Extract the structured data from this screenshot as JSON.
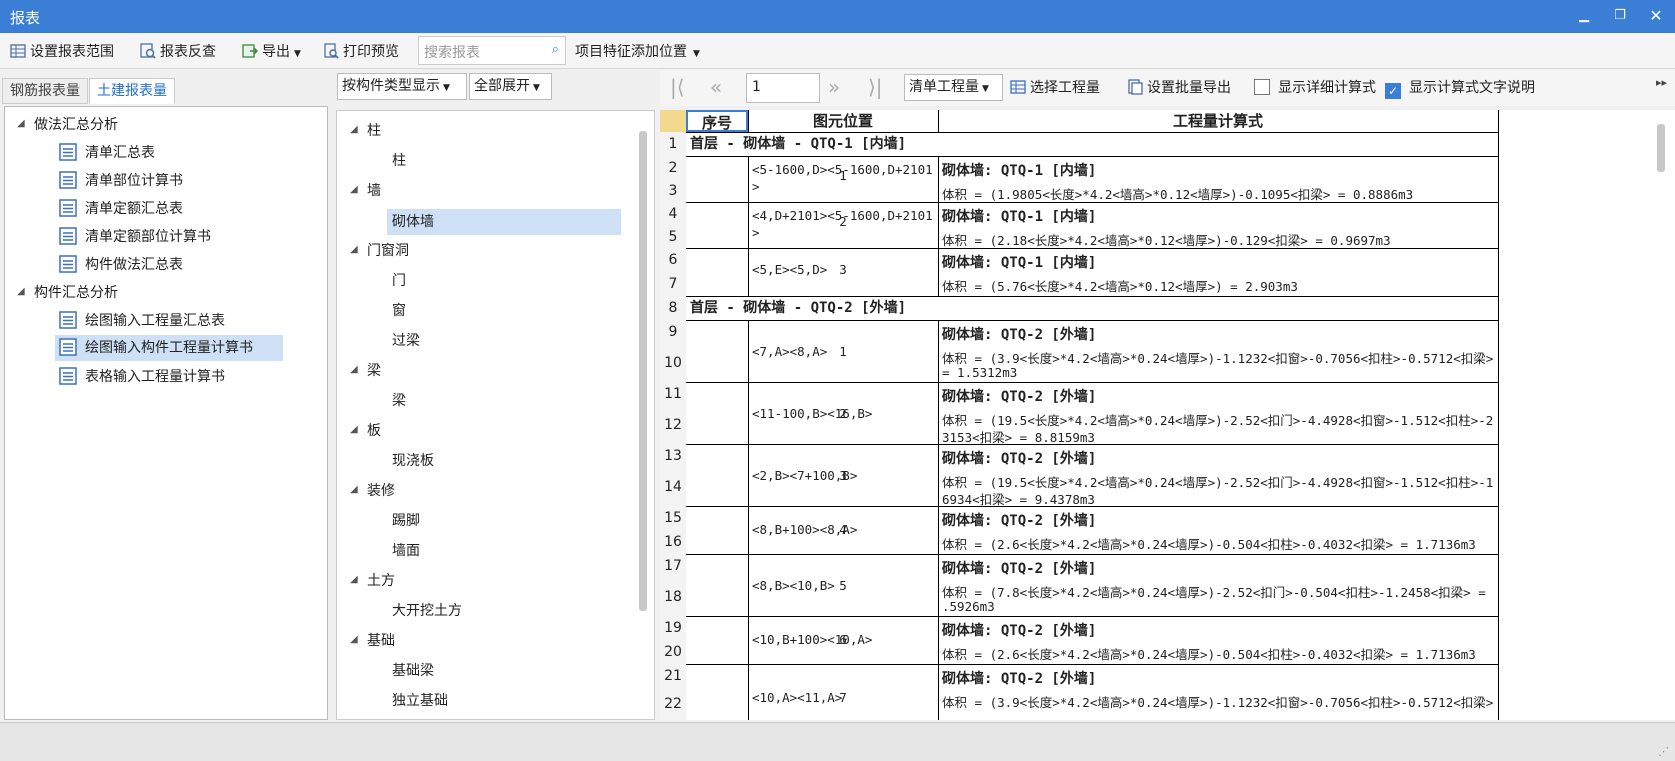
{
  "window": {
    "title": "报表"
  },
  "toolbar": {
    "set_range": "设置报表范围",
    "reverse_check": "报表反查",
    "export": "导出",
    "print_preview": "打印预览",
    "search_placeholder": "搜索报表",
    "add_feature_position": "项目特征添加位置"
  },
  "tabs": {
    "rebar": "钢筋报表量",
    "civil": "土建报表量"
  },
  "report_tree": {
    "group1": "做法汇总分析",
    "group1_items": [
      "清单汇总表",
      "清单部位计算书",
      "清单定额汇总表",
      "清单定额部位计算书",
      "构件做法汇总表"
    ],
    "group2": "构件汇总分析",
    "group2_items": [
      "绘图输入工程量汇总表",
      "绘图输入构件工程量计算书",
      "表格输入工程量计算书"
    ]
  },
  "middle": {
    "display_mode": "按构件类型显示",
    "expand_mode": "全部展开",
    "tree": [
      {
        "cat": "柱",
        "items": [
          "柱"
        ]
      },
      {
        "cat": "墙",
        "items": [
          "砌体墙"
        ]
      },
      {
        "cat": "门窗洞",
        "items": [
          "门",
          "窗",
          "过梁"
        ]
      },
      {
        "cat": "梁",
        "items": [
          "梁"
        ]
      },
      {
        "cat": "板",
        "items": [
          "现浇板"
        ]
      },
      {
        "cat": "装修",
        "items": [
          "踢脚",
          "墙面"
        ]
      },
      {
        "cat": "土方",
        "items": [
          "大开挖土方"
        ]
      },
      {
        "cat": "基础",
        "items": [
          "基础梁",
          "独立基础"
        ]
      }
    ]
  },
  "right_toolbar": {
    "page": "1",
    "quantity_type": "清单工程量",
    "select_quantity": "选择工程量",
    "batch_export": "设置批量导出",
    "show_detail": "显示详细计算式",
    "show_detail_checked": false,
    "show_text_desc": "显示计算式文字说明",
    "show_text_desc_checked": true
  },
  "table": {
    "headers": {
      "seq": "序号",
      "position": "图元位置",
      "formula": "工程量计算式"
    },
    "row_numbers": [
      "1",
      "2",
      "3",
      "4",
      "5",
      "6",
      "7",
      "8",
      "9",
      "10",
      "11",
      "12",
      "13",
      "14",
      "15",
      "16",
      "17",
      "18",
      "19",
      "20",
      "21",
      "22"
    ],
    "sections": {
      "s1": "首层 - 砌体墙 - QTQ-1 [内墙]",
      "s2": "首层 - 砌体墙 - QTQ-2 [外墙]"
    },
    "entries": [
      {
        "seq": "1",
        "pos1": "<5-1600,D><5-1600,D+2101",
        "pos2": ">",
        "name": "砌体墙: QTQ-1 [内墙]",
        "f1": "体积 = (1.9805<长度>*4.2<墙高>*0.12<墙厚>)-0.1095<扣梁> = 0.8886m3",
        "f2": ""
      },
      {
        "seq": "2",
        "pos1": "<4,D+2101><5-1600,D+2101",
        "pos2": ">",
        "name": "砌体墙: QTQ-1 [内墙]",
        "f1": "体积 = (2.18<长度>*4.2<墙高>*0.12<墙厚>)-0.129<扣梁> = 0.9697m3",
        "f2": ""
      },
      {
        "seq": "3",
        "pos1": "<5,E><5,D>",
        "pos2": "",
        "name": "砌体墙: QTQ-1 [内墙]",
        "f1": "体积 = (5.76<长度>*4.2<墙高>*0.12<墙厚>) = 2.903m3",
        "f2": ""
      },
      {
        "seq": "1",
        "pos1": "<7,A><8,A>",
        "pos2": "",
        "name": "砌体墙: QTQ-2 [外墙]",
        "f1": "体积 = (3.9<长度>*4.2<墙高>*0.24<墙厚>)-1.1232<扣窗>-0.7056<扣柱>-0.5712<扣梁>",
        "f2": "= 1.5312m3"
      },
      {
        "seq": "2",
        "pos1": "<11-100,B><16,B>",
        "pos2": "",
        "name": "砌体墙: QTQ-2 [外墙]",
        "f1": "体积 = (19.5<长度>*4.2<墙高>*0.24<墙厚>)-2.52<扣门>-4.4928<扣窗>-1.512<扣柱>-2.",
        "f2": "3153<扣梁> = 8.8159m3"
      },
      {
        "seq": "3",
        "pos1": "<2,B><7+100,B>",
        "pos2": "",
        "name": "砌体墙: QTQ-2 [外墙]",
        "f1": "体积 = (19.5<长度>*4.2<墙高>*0.24<墙厚>)-2.52<扣门>-4.4928<扣窗>-1.512<扣柱>-1.",
        "f2": "6934<扣梁> = 9.4378m3"
      },
      {
        "seq": "4",
        "pos1": "<8,B+100><8,A>",
        "pos2": "",
        "name": "砌体墙: QTQ-2 [外墙]",
        "f1": "体积 = (2.6<长度>*4.2<墙高>*0.24<墙厚>)-0.504<扣柱>-0.4032<扣梁> = 1.7136m3",
        "f2": ""
      },
      {
        "seq": "5",
        "pos1": "<8,B><10,B>",
        "pos2": "",
        "name": "砌体墙: QTQ-2 [外墙]",
        "f1": "体积 = (7.8<长度>*4.2<墙高>*0.24<墙厚>)-2.52<扣门>-0.504<扣柱>-1.2458<扣梁> = 3",
        "f2": ".5926m3"
      },
      {
        "seq": "6",
        "pos1": "<10,B+100><10,A>",
        "pos2": "",
        "name": "砌体墙: QTQ-2 [外墙]",
        "f1": "体积 = (2.6<长度>*4.2<墙高>*0.24<墙厚>)-0.504<扣柱>-0.4032<扣梁> = 1.7136m3",
        "f2": ""
      },
      {
        "seq": "7",
        "pos1": "<10,A><11,A>",
        "pos2": "",
        "name": "砌体墙: QTQ-2 [外墙]",
        "f1": "体积 = (3.9<长度>*4.2<墙高>*0.24<墙厚>)-1.1232<扣窗>-0.7056<扣柱>-0.5712<扣梁>",
        "f2": ""
      }
    ]
  },
  "colors": {
    "titlebar": "#3a7fd5",
    "accent": "#1f6fd0",
    "selection": "#cde0f5",
    "doc_icon": "#3b6fc4"
  }
}
